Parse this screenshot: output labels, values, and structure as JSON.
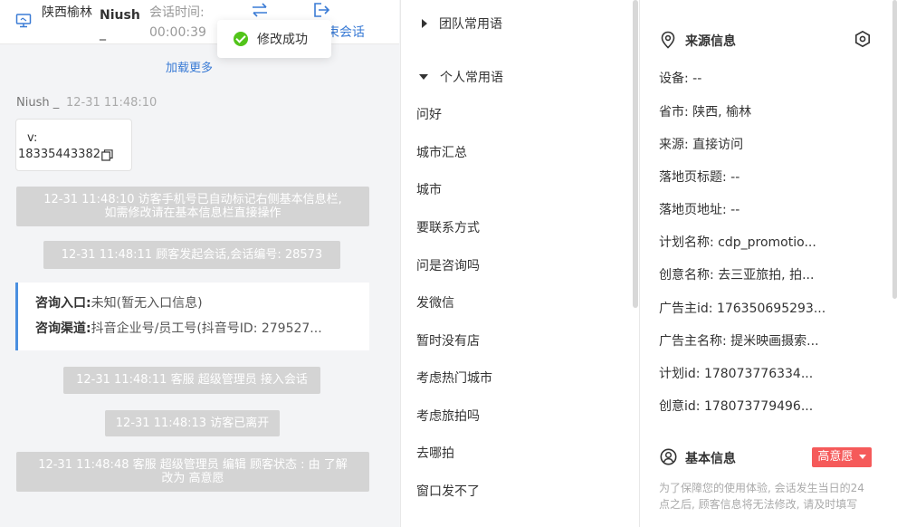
{
  "header": {
    "location": "陕西榆林",
    "name": "Niush",
    "name_suffix": "_",
    "session_label": "会话时间:",
    "session_time": "00:00:39",
    "end_session": "束会话"
  },
  "toast": {
    "text": "修改成功"
  },
  "chat": {
    "load_more": "加载更多",
    "message": {
      "sender": "Niush _",
      "time": "12-31 11:48:10",
      "line1": "v:",
      "line2": "18335443382"
    },
    "sys1_line1": "12-31 11:48:10 访客手机号已自动标记右侧基本信息栏,",
    "sys1_line2": "如需修改请在基本信息栏直接操作",
    "sys2": "12-31 11:48:11 顾客发起会话,会话编号: 28573",
    "card": {
      "entry_label": "咨询入口:",
      "entry_value": "未知(暂无入口信息)",
      "channel_label": "咨询渠道:",
      "channel_value": "抖音企业号/员工号(抖音号ID: 279527..."
    },
    "sys3": "12-31 11:48:11 客服 超级管理员 接入会话",
    "sys4": "12-31 11:48:13 访客已离开",
    "sys5_line1": "12-31 11:48:48 客服 超级管理员 编辑 顾客状态 : 由 了解",
    "sys5_line2": "改为 高意愿"
  },
  "quick_replies": {
    "team_group": "团队常用语",
    "personal_group": "个人常用语",
    "items": [
      "问好",
      "城市汇总",
      "城市",
      "要联系方式",
      "问是咨询吗",
      "发微信",
      "暂时没有店",
      "考虑热门城市",
      "考虑旅拍吗",
      "去哪拍",
      "窗口发不了"
    ]
  },
  "source_info": {
    "title": "来源信息",
    "device": "设备: --",
    "province": "省市: 陕西, 榆林",
    "source": "来源: 直接访问",
    "landing_title": "落地页标题: --",
    "landing_url": "落地页地址: --",
    "plan_name": "计划名称: cdp_promotio...",
    "creative_name": "创意名称: 去三亚旅拍, 拍...",
    "advertiser_id": "广告主id: 176350695293...",
    "advertiser_name": "广告主名称: 提米映画摄索...",
    "plan_id": "计划id: 178073776334...",
    "creative_id": "创意id: 178073779496..."
  },
  "basic_info": {
    "title": "基本信息",
    "badge": "高意愿",
    "note": "为了保障您的使用体验, 会话发生当日的24点之后, 顾客信息将无法修改, 请及时填写"
  },
  "colors": {
    "accent": "#3a7bd5",
    "success": "#52c41a",
    "badge": "#f55a5a",
    "system_message": "#d4d4d4"
  },
  "icons": {
    "header_device": "monitor-icon",
    "transfer": "swap-arrows-icon",
    "end": "exit-icon",
    "copy": "copy-icon",
    "source": "location-pin-icon",
    "settings": "hexagon-settings-icon",
    "basic": "user-circle-icon",
    "badge_dropdown": "caret-down-icon"
  }
}
